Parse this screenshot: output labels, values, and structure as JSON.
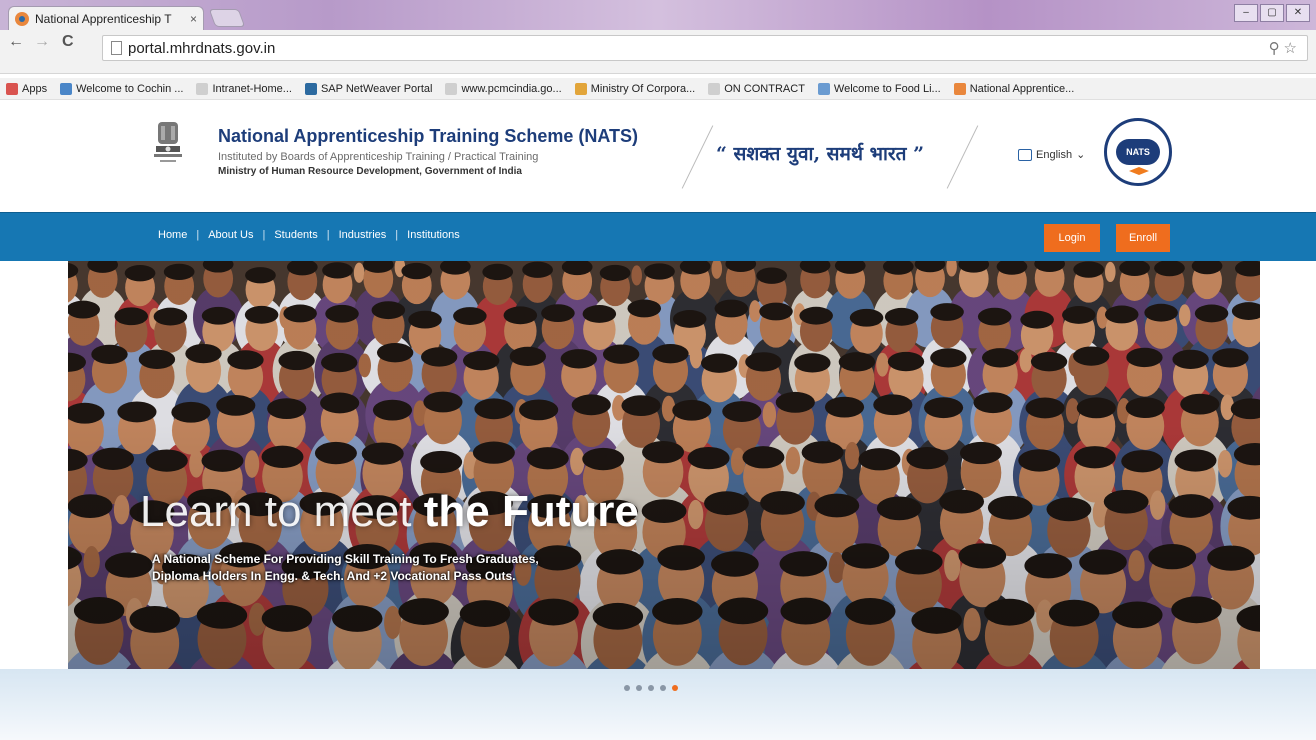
{
  "browser": {
    "tab_title": "National Apprenticeship T",
    "tab_close": "×",
    "url": "portal.mhrdnats.gov.in",
    "window_controls": [
      "‒",
      "▢",
      "✕"
    ],
    "nav": {
      "back": "←",
      "forward": "→",
      "reload": "C"
    },
    "omnibox_icons": "⚲☆"
  },
  "bookmarks": [
    {
      "label": "Apps",
      "color": "#d9534f"
    },
    {
      "label": "Welcome to Cochin ...",
      "color": "#4a86c8"
    },
    {
      "label": "Intranet-Home...",
      "color": "#cfcfcf"
    },
    {
      "label": "SAP NetWeaver Portal",
      "color": "#2c6aa0"
    },
    {
      "label": "www.pcmcindia.go...",
      "color": "#cfcfcf"
    },
    {
      "label": "Ministry Of Corpora...",
      "color": "#e2a53a"
    },
    {
      "label": "ON CONTRACT",
      "color": "#cfcfcf"
    },
    {
      "label": "Welcome to Food Li...",
      "color": "#6a9bd1"
    },
    {
      "label": "National Apprentice...",
      "color": "#e9873d"
    }
  ],
  "header": {
    "title": "National Apprenticeship Training Scheme (NATS)",
    "subtitle": "Instituted by Boards of Apprenticeship Training / Practical Training",
    "ministry": "Ministry of Human Resource Development, Government of India",
    "tagline": "“ सशक्त युवा, समर्थ भारत ”",
    "language": "English",
    "language_caret": "⌄",
    "logo_text": "NATS"
  },
  "nav": {
    "links": [
      "Home",
      "About Us",
      "Students",
      "Industries",
      "Institutions"
    ],
    "separator": "|",
    "login": "Login",
    "enroll": "Enroll"
  },
  "hero": {
    "title_light": "Learn to meet ",
    "title_bold": "the Future",
    "description_line1": "A National Scheme For Providing Skill Training To Fresh Graduates,",
    "description_line2": "Diploma Holders In Engg. & Tech. And +2 Vocational Pass Outs."
  },
  "carousel": {
    "slide_count": 5,
    "active_index": 4
  },
  "colors": {
    "nav_blue": "#1677b3",
    "accent_orange": "#ef6d1e",
    "brand_navy": "#1d3d7a"
  }
}
